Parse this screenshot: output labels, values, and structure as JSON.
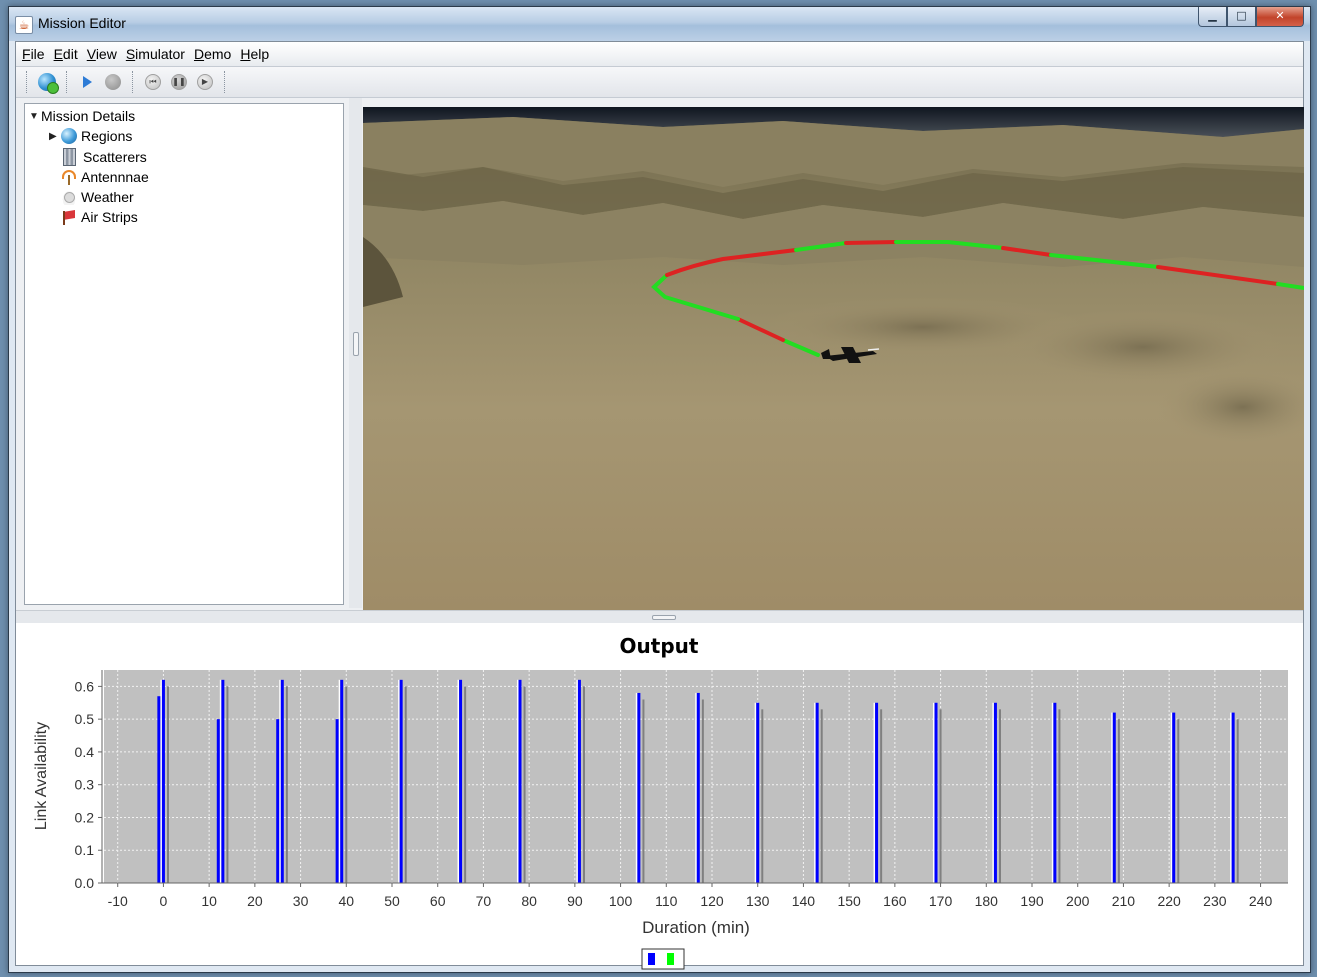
{
  "window": {
    "title": "Mission Editor"
  },
  "menu": [
    "File",
    "Edit",
    "View",
    "Simulator",
    "Demo",
    "Help"
  ],
  "tree": {
    "root": "Mission Details",
    "items": [
      "Regions",
      "Scatterers",
      "Antennnae",
      "Weather",
      "Air Strips"
    ]
  },
  "colors": {
    "link_up": "#00ff00",
    "link_down": "#ff0000",
    "series_blue": "#0000ff",
    "series_gray": "#808080",
    "plot_bg": "#c0c0c0"
  },
  "chart_data": {
    "type": "bar",
    "title": "Output",
    "xlabel": "Duration (min)",
    "ylabel": "Link Availability",
    "xlim": [
      -13,
      246
    ],
    "ylim": [
      0,
      0.65
    ],
    "xticks": [
      -10,
      0,
      10,
      20,
      30,
      40,
      50,
      60,
      70,
      80,
      90,
      100,
      110,
      120,
      130,
      140,
      150,
      160,
      170,
      180,
      190,
      200,
      210,
      220,
      230,
      240
    ],
    "yticks": [
      0.0,
      0.1,
      0.2,
      0.3,
      0.4,
      0.5,
      0.6
    ],
    "grid": true,
    "legend": "bottom-center",
    "series": [
      {
        "color": "blue",
        "points": [
          [
            -1,
            0.57
          ],
          [
            0,
            0.62
          ],
          [
            12,
            0.5
          ],
          [
            13,
            0.62
          ],
          [
            25,
            0.5
          ],
          [
            26,
            0.62
          ],
          [
            38,
            0.5
          ],
          [
            39,
            0.62
          ],
          [
            52,
            0.62
          ],
          [
            65,
            0.62
          ],
          [
            78,
            0.62
          ],
          [
            91,
            0.62
          ],
          [
            104,
            0.58
          ],
          [
            117,
            0.58
          ],
          [
            130,
            0.55
          ],
          [
            143,
            0.55
          ],
          [
            156,
            0.55
          ],
          [
            169,
            0.55
          ],
          [
            182,
            0.55
          ],
          [
            195,
            0.55
          ],
          [
            208,
            0.52
          ],
          [
            221,
            0.52
          ],
          [
            234,
            0.52
          ]
        ]
      },
      {
        "color": "gray",
        "points": [
          [
            1,
            0.6
          ],
          [
            14,
            0.6
          ],
          [
            27,
            0.6
          ],
          [
            40,
            0.6
          ],
          [
            53,
            0.6
          ],
          [
            66,
            0.6
          ],
          [
            79,
            0.6
          ],
          [
            92,
            0.6
          ],
          [
            105,
            0.56
          ],
          [
            118,
            0.56
          ],
          [
            131,
            0.53
          ],
          [
            144,
            0.53
          ],
          [
            157,
            0.53
          ],
          [
            170,
            0.53
          ],
          [
            183,
            0.53
          ],
          [
            196,
            0.53
          ],
          [
            209,
            0.5
          ],
          [
            222,
            0.5
          ],
          [
            235,
            0.5
          ]
        ]
      },
      {
        "color": "white",
        "points": [
          [
            -0.5,
            0.62
          ],
          [
            12.5,
            0.62
          ],
          [
            25.5,
            0.62
          ],
          [
            38.5,
            0.62
          ],
          [
            51.5,
            0.62
          ],
          [
            64.5,
            0.62
          ],
          [
            77.5,
            0.62
          ],
          [
            90.5,
            0.62
          ],
          [
            103.5,
            0.58
          ],
          [
            116.5,
            0.58
          ],
          [
            129.5,
            0.55
          ],
          [
            142.5,
            0.55
          ],
          [
            155.5,
            0.55
          ],
          [
            168.5,
            0.55
          ],
          [
            181.5,
            0.55
          ],
          [
            194.5,
            0.55
          ],
          [
            207.5,
            0.52
          ],
          [
            220.5,
            0.52
          ],
          [
            233.5,
            0.52
          ]
        ]
      }
    ]
  }
}
